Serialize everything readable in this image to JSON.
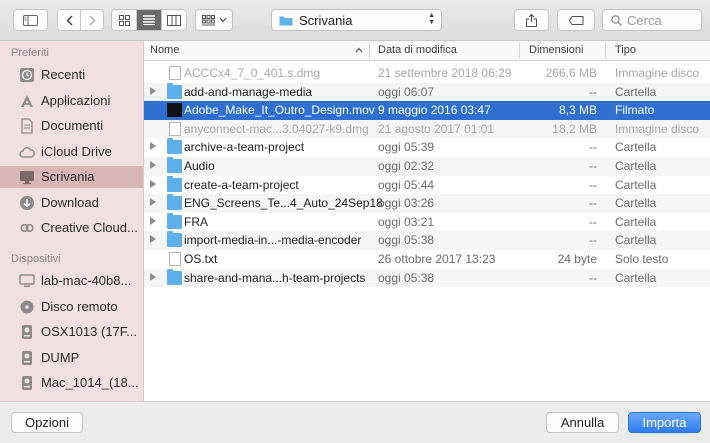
{
  "toolbar": {
    "location": "Scrivania",
    "search_placeholder": "Cerca"
  },
  "sidebar": {
    "favorites_header": "Preferiti",
    "favorites": [
      {
        "label": "Recenti",
        "icon": "clock-icon"
      },
      {
        "label": "Applicazioni",
        "icon": "applications-icon"
      },
      {
        "label": "Documenti",
        "icon": "document-icon"
      },
      {
        "label": "iCloud Drive",
        "icon": "cloud-icon"
      },
      {
        "label": "Scrivania",
        "icon": "desktop-icon",
        "selected": true
      },
      {
        "label": "Download",
        "icon": "download-icon"
      },
      {
        "label": "Creative Cloud...",
        "icon": "creative-cloud-icon"
      }
    ],
    "devices_header": "Dispositivi",
    "devices": [
      {
        "label": "lab-mac-40b8...",
        "icon": "computer-icon"
      },
      {
        "label": "Disco remoto",
        "icon": "disc-icon"
      },
      {
        "label": "OSX1013 (17F...",
        "icon": "drive-icon"
      },
      {
        "label": "DUMP",
        "icon": "drive-icon"
      },
      {
        "label": "Mac_1014_(18...",
        "icon": "drive-icon"
      },
      {
        "label": "",
        "icon": "drive-icon"
      }
    ]
  },
  "columns": {
    "name": "Nome",
    "date": "Data di modifica",
    "size": "Dimensioni",
    "kind": "Tipo"
  },
  "files": [
    {
      "name": "ACCCx4_7_0_401.s.dmg",
      "date": "21 settembre 2018 06:29",
      "size": "266,6 MB",
      "kind": "Immagine disco",
      "type": "file",
      "dim": true
    },
    {
      "name": "add-and-manage-media",
      "date": "oggi 06:07",
      "size": "--",
      "kind": "Cartella",
      "type": "folder"
    },
    {
      "name": "Adobe_Make_It_Outro_Design.mov",
      "date": "9 maggio 2016 03:47",
      "size": "8,3 MB",
      "kind": "Filmato",
      "type": "movie",
      "selected": true
    },
    {
      "name": "anyconnect-mac...3.04027-k9.dmg",
      "date": "21 agosto 2017 01:01",
      "size": "18,2 MB",
      "kind": "Immagine disco",
      "type": "file",
      "dim": true
    },
    {
      "name": "archive-a-team-project",
      "date": "oggi 05:39",
      "size": "--",
      "kind": "Cartella",
      "type": "folder"
    },
    {
      "name": "Audio",
      "date": "oggi 02:32",
      "size": "--",
      "kind": "Cartella",
      "type": "folder"
    },
    {
      "name": "create-a-team-project",
      "date": "oggi 05:44",
      "size": "--",
      "kind": "Cartella",
      "type": "folder"
    },
    {
      "name": "ENG_Screens_Te...4_Auto_24Sep18",
      "date": "oggi 03:26",
      "size": "--",
      "kind": "Cartella",
      "type": "folder"
    },
    {
      "name": "FRA",
      "date": "oggi 03:21",
      "size": "--",
      "kind": "Cartella",
      "type": "folder"
    },
    {
      "name": "import-media-in...-media-encoder",
      "date": "oggi 05:38",
      "size": "--",
      "kind": "Cartella",
      "type": "folder"
    },
    {
      "name": "OS.txt",
      "date": "26 ottobre 2017 13:23",
      "size": "24 byte",
      "kind": "Solo testo",
      "type": "doc"
    },
    {
      "name": "share-and-mana...h-team-projects",
      "date": "oggi 05:38",
      "size": "--",
      "kind": "Cartella",
      "type": "folder"
    }
  ],
  "footer": {
    "options_label": "Opzioni",
    "cancel_label": "Annulla",
    "import_label": "Importa"
  }
}
